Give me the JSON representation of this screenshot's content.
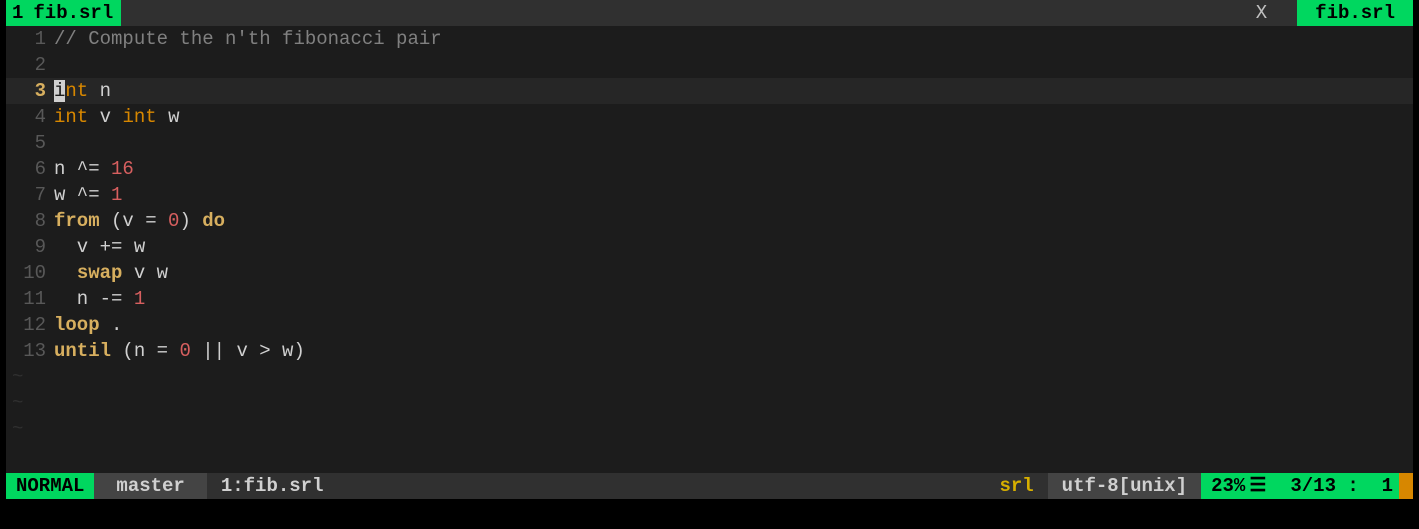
{
  "tabs": {
    "left_index": "1",
    "left_name": "fib.srl",
    "close_glyph": "X",
    "right_name": "fib.srl"
  },
  "code": {
    "lines": [
      {
        "n": "1",
        "current": false,
        "tokens": [
          {
            "t": "// Compute the n'th fibonacci pair",
            "c": "c-comment"
          }
        ]
      },
      {
        "n": "2",
        "current": false,
        "tokens": []
      },
      {
        "n": "3",
        "current": true,
        "tokens": [
          {
            "t": "i",
            "c": "cursor-block"
          },
          {
            "t": "nt",
            "c": "c-type"
          },
          {
            "t": " ",
            "c": "c-ident"
          },
          {
            "t": "n",
            "c": "c-ident"
          }
        ]
      },
      {
        "n": "4",
        "current": false,
        "tokens": [
          {
            "t": "int",
            "c": "c-type"
          },
          {
            "t": " ",
            "c": ""
          },
          {
            "t": "v",
            "c": "c-ident"
          },
          {
            "t": " ",
            "c": ""
          },
          {
            "t": "int",
            "c": "c-type"
          },
          {
            "t": " ",
            "c": ""
          },
          {
            "t": "w",
            "c": "c-ident"
          }
        ]
      },
      {
        "n": "5",
        "current": false,
        "tokens": []
      },
      {
        "n": "6",
        "current": false,
        "tokens": [
          {
            "t": "n ^= ",
            "c": "c-ident"
          },
          {
            "t": "16",
            "c": "c-num"
          }
        ]
      },
      {
        "n": "7",
        "current": false,
        "tokens": [
          {
            "t": "w ^= ",
            "c": "c-ident"
          },
          {
            "t": "1",
            "c": "c-num"
          }
        ]
      },
      {
        "n": "8",
        "current": false,
        "tokens": [
          {
            "t": "from",
            "c": "c-kw"
          },
          {
            "t": " (v = ",
            "c": "c-ident"
          },
          {
            "t": "0",
            "c": "c-num"
          },
          {
            "t": ") ",
            "c": "c-ident"
          },
          {
            "t": "do",
            "c": "c-kw"
          }
        ]
      },
      {
        "n": "9",
        "current": false,
        "tokens": [
          {
            "t": "  v += w",
            "c": "c-ident"
          }
        ]
      },
      {
        "n": "10",
        "current": false,
        "tokens": [
          {
            "t": "  ",
            "c": ""
          },
          {
            "t": "swap",
            "c": "c-kw"
          },
          {
            "t": " v w",
            "c": "c-ident"
          }
        ]
      },
      {
        "n": "11",
        "current": false,
        "tokens": [
          {
            "t": "  n -= ",
            "c": "c-ident"
          },
          {
            "t": "1",
            "c": "c-num"
          }
        ]
      },
      {
        "n": "12",
        "current": false,
        "tokens": [
          {
            "t": "loop",
            "c": "c-kw"
          },
          {
            "t": " .",
            "c": "c-ident"
          }
        ]
      },
      {
        "n": "13",
        "current": false,
        "tokens": [
          {
            "t": "until",
            "c": "c-kw"
          },
          {
            "t": " (n = ",
            "c": "c-ident"
          },
          {
            "t": "0",
            "c": "c-num"
          },
          {
            "t": " || v > w)",
            "c": "c-ident"
          }
        ]
      }
    ],
    "tildes": 3
  },
  "status": {
    "mode": "NORMAL",
    "branch": "master",
    "buffer_index": "1",
    "buffer_name": "fib.srl",
    "filetype": "srl",
    "encoding": "utf-8[unix]",
    "percent": "23%",
    "percent_glyph": "☰",
    "pos_line": "3",
    "pos_total": "13",
    "pos_col": "1"
  }
}
